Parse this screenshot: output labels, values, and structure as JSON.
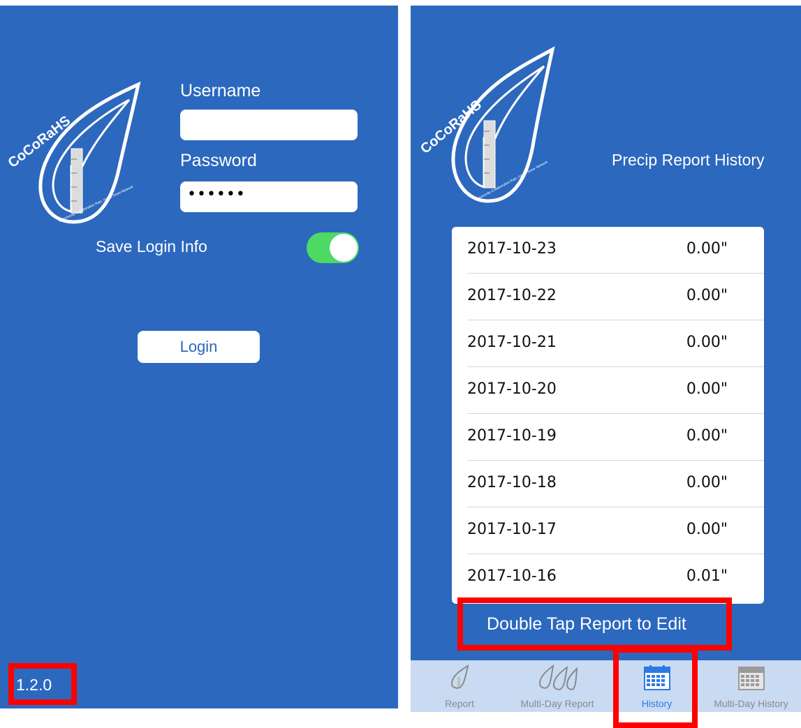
{
  "login_screen": {
    "logo_text": "CoCoRaHS",
    "logo_subtext": "Community Collaborative Rain, Hail & Snow Network",
    "username_label": "Username",
    "username_value": "",
    "password_label": "Password",
    "password_value": "••••••",
    "save_login_label": "Save Login Info",
    "save_login_on": true,
    "login_button": "Login",
    "version": "1.2.0"
  },
  "history_screen": {
    "logo_text": "CoCoRaHS",
    "logo_subtext": "Community Collaborative Rain, Hail & Snow Network",
    "title": "Precip Report History",
    "reports": [
      {
        "date": "2017-10-23",
        "amount": "0.00\""
      },
      {
        "date": "2017-10-22",
        "amount": "0.00\""
      },
      {
        "date": "2017-10-21",
        "amount": "0.00\""
      },
      {
        "date": "2017-10-20",
        "amount": "0.00\""
      },
      {
        "date": "2017-10-19",
        "amount": "0.00\""
      },
      {
        "date": "2017-10-18",
        "amount": "0.00\""
      },
      {
        "date": "2017-10-17",
        "amount": "0.00\""
      },
      {
        "date": "2017-10-16",
        "amount": "0.01\""
      }
    ],
    "hint": "Double Tap Report to Edit",
    "tabs": [
      {
        "label": "Report",
        "icon": "raindrop-icon",
        "active": false
      },
      {
        "label": "Multi-Day Report",
        "icon": "multi-raindrop-icon",
        "active": false
      },
      {
        "label": "History",
        "icon": "calendar-icon",
        "active": true
      },
      {
        "label": "Multi-Day History",
        "icon": "calendar-icon",
        "active": false
      }
    ]
  },
  "colors": {
    "background_blue": "#2c68be",
    "highlight_red": "#ff0000",
    "toggle_green": "#4cd964",
    "tabbar_bg": "#c9daf3",
    "tab_active": "#2c7be5"
  }
}
